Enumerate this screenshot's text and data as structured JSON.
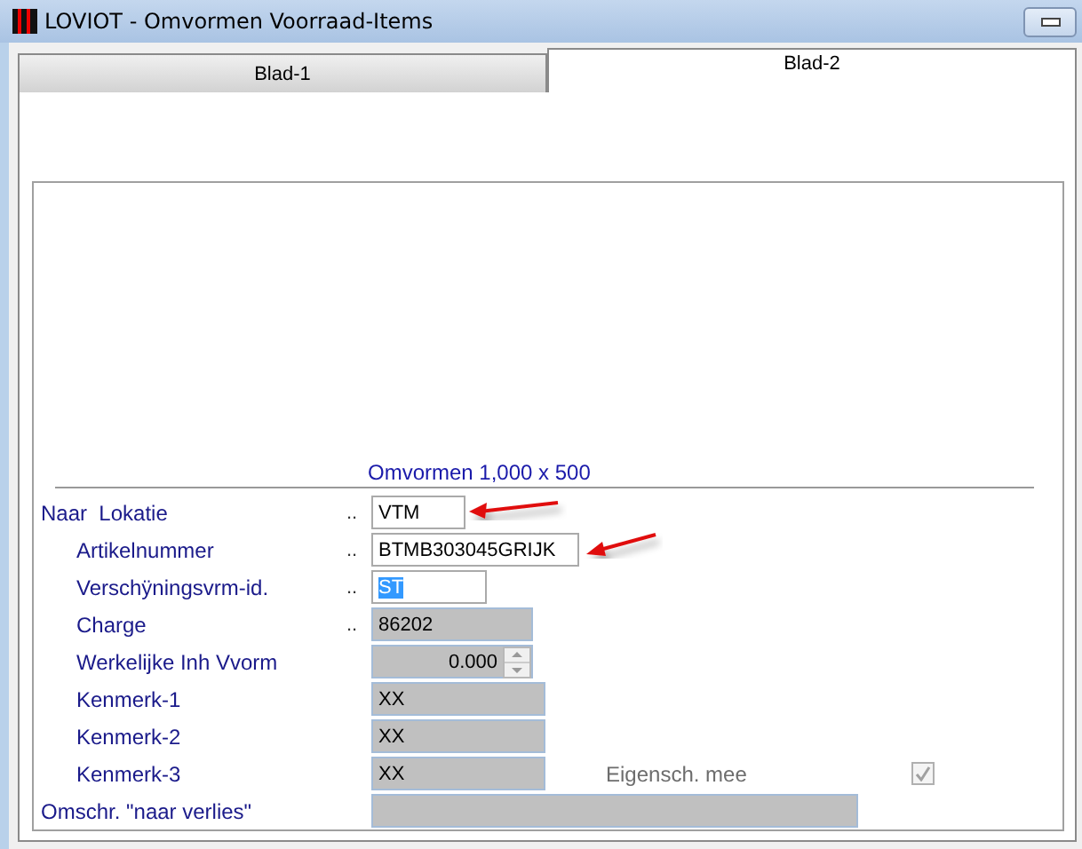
{
  "window": {
    "title": "LOVIOT - Omvormen Voorraad-Items"
  },
  "tabs": [
    {
      "label": "Blad-1",
      "selected": false
    },
    {
      "label": "Blad-2",
      "selected": true
    }
  ],
  "section": {
    "title": "Omvormen 1,000 x 500"
  },
  "fields": [
    {
      "label": "Naar  Lokatie",
      "indent": false,
      "dots": "..",
      "kind": "text",
      "value": "VTM"
    },
    {
      "label": "Artikelnummer",
      "indent": true,
      "dots": "..",
      "kind": "text",
      "value": "BTMB303045GRIJK"
    },
    {
      "label": "Verschÿningsvrm-id.",
      "indent": true,
      "dots": "..",
      "kind": "text",
      "value": "ST",
      "highlighted": true
    },
    {
      "label": "Charge",
      "indent": true,
      "dots": "..",
      "kind": "readonly",
      "value": "86202"
    },
    {
      "label": "Werkelijke Inh Vvorm",
      "indent": true,
      "kind": "spinner",
      "value": "0.000"
    },
    {
      "label": "Kenmerk-1",
      "indent": true,
      "kind": "readonly",
      "value": "XX"
    },
    {
      "label": "Kenmerk-2",
      "indent": true,
      "kind": "readonly",
      "value": "XX"
    },
    {
      "label": "Kenmerk-3",
      "indent": true,
      "kind": "readonly",
      "value": "XX",
      "extra": {
        "label": "Eigensch. mee",
        "checked": true,
        "disabled": true
      }
    },
    {
      "label": "Omschr. \"naar verlies\"",
      "indent": false,
      "kind": "readonly"
    }
  ]
}
